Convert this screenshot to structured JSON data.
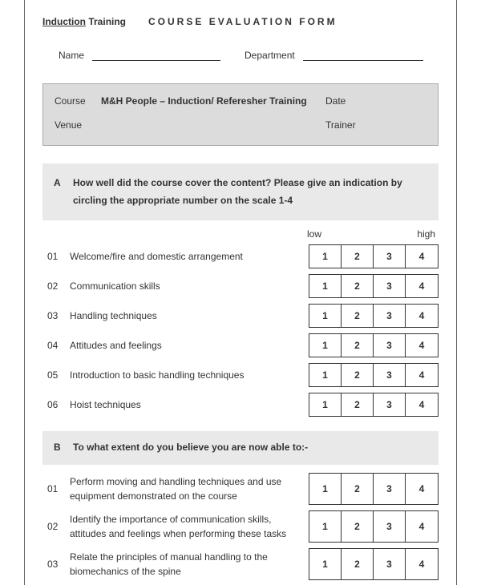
{
  "header": {
    "induction": "Induction",
    "training": "Training",
    "title": "COURSE EVALUATION FORM"
  },
  "fields": {
    "name_label": "Name",
    "department_label": "Department"
  },
  "course_block": {
    "course_label": "Course",
    "course_value": "M&H People – Induction/ Referesher Training",
    "date_label": "Date",
    "venue_label": "Venue",
    "trainer_label": "Trainer"
  },
  "section_a": {
    "letter": "A",
    "text": "How well did the course cover the content? Please give an indication by circling the appropriate number on the scale 1-4",
    "scale_low": "low",
    "scale_high": "high",
    "items": [
      {
        "num": "01",
        "text": "Welcome/fire and domestic arrangement"
      },
      {
        "num": "02",
        "text": "Communication skills"
      },
      {
        "num": "03",
        "text": "Handling techniques"
      },
      {
        "num": "04",
        "text": "Attitudes and feelings"
      },
      {
        "num": "05",
        "text": "Introduction to basic handling techniques"
      },
      {
        "num": "06",
        "text": "Hoist techniques"
      }
    ]
  },
  "section_b": {
    "letter": "B",
    "text": "To what extent do you believe you are now able to:-",
    "items": [
      {
        "num": "01",
        "text": "Perform moving and handling techniques and use equipment demonstrated on the course"
      },
      {
        "num": "02",
        "text": "Identify the importance of communication skills, attitudes and feelings when performing these tasks"
      },
      {
        "num": "03",
        "text": "Relate the principles of manual handling to the biomechanics of the spine"
      }
    ]
  },
  "rating_values": [
    "1",
    "2",
    "3",
    "4"
  ]
}
